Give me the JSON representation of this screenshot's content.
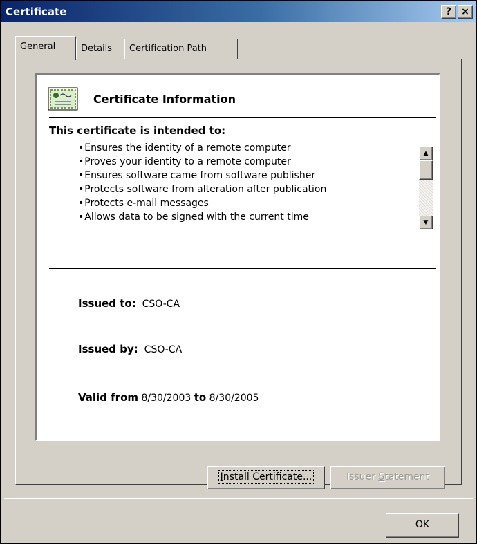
{
  "window": {
    "title": "Certificate",
    "help_label": "?",
    "close_label": "×"
  },
  "tabs": [
    {
      "label": "General",
      "active": true
    },
    {
      "label": "Details",
      "active": false
    },
    {
      "label": "Certification Path",
      "active": false
    }
  ],
  "cert_info": {
    "icon": "certificate-icon",
    "title": "Certificate Information",
    "intended_heading": "This certificate is intended to:",
    "purposes": [
      "Ensures the identity of a remote computer",
      "Proves your identity to a remote computer",
      "Ensures software came from software publisher",
      "Protects software from alteration after publication",
      "Protects e-mail messages",
      "Allows data to be signed with the current time"
    ],
    "issued_to_label": "Issued to:",
    "issued_to": "CSO-CA",
    "issued_by_label": "Issued by:",
    "issued_by": "CSO-CA",
    "valid_from_label": "Valid from",
    "valid_from": "8/30/2003",
    "valid_to_label": "to",
    "valid_to": "8/30/2005"
  },
  "buttons": {
    "install_pre": "",
    "install_accel": "I",
    "install_post": "nstall Certificate...",
    "issuer_pre": "Issuer ",
    "issuer_accel": "S",
    "issuer_post": "tatement",
    "ok": "OK"
  },
  "colors": {
    "titlebar_start": "#0a246a",
    "titlebar_end": "#a6caf0",
    "face": "#d4d0c8"
  }
}
